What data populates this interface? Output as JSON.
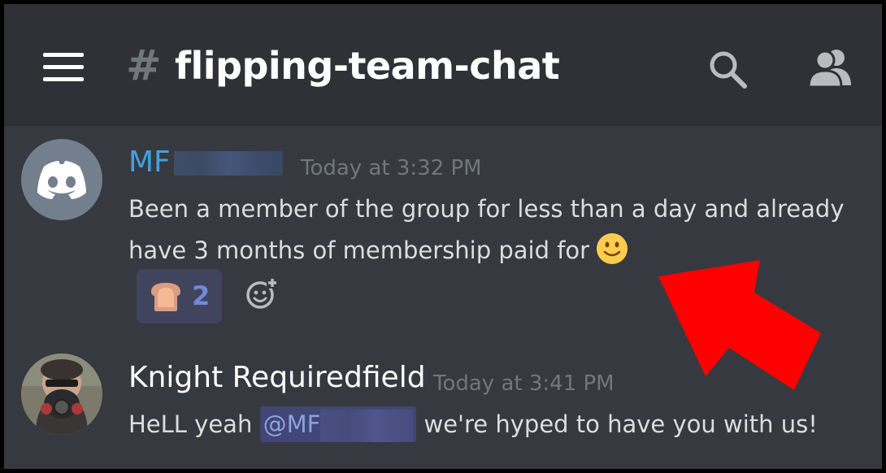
{
  "header": {
    "channel_hash": "#",
    "channel_name": "flipping-team-chat",
    "icons": [
      "menu-icon",
      "search-icon",
      "members-icon"
    ]
  },
  "messages": [
    {
      "username": "MF",
      "timestamp": "Today at 3:32 PM",
      "text_line_1": "Been a member of the group for less than a day and already",
      "text_line_2": "have 3 months of membership paid for",
      "emoji": "slightly-smiling-face",
      "reactions": [
        {
          "emoji": "bread",
          "count": "2"
        }
      ]
    },
    {
      "username": "Knight Requiredfield",
      "timestamp": "Today at 3:41 PM",
      "text_prefix": "HeLL yeah",
      "mention": "@MF",
      "text_suffix": "we're hyped to have you with us!"
    }
  ],
  "colors": {
    "background": "#36393f",
    "header": "#2f3136",
    "username_blue": "#3fa3e0",
    "mention_text": "#8ea1e1",
    "mention_bg": "#414675",
    "reaction_bg": "#40455d",
    "reaction_count": "#7289da",
    "timestamp": "#72767d",
    "annotation_arrow": "#ff0000"
  }
}
